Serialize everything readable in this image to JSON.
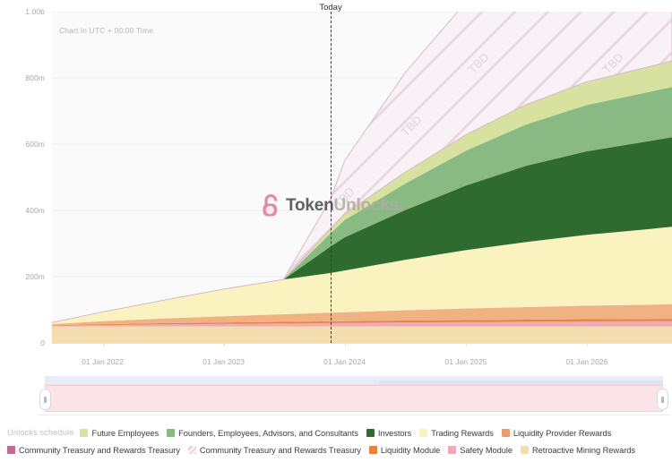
{
  "chart_data": {
    "type": "area",
    "title": "",
    "subtitle": "Chart in UTC + 00:00 Time",
    "xlabel": "",
    "ylabel": "",
    "ylim": [
      0,
      1000000000
    ],
    "grid": true,
    "legend_position": "bottom",
    "stacked": true,
    "marker": {
      "label": "Today",
      "x": "2023-11-20"
    },
    "hatch_label": "TBD",
    "y_ticks": [
      {
        "value": 0,
        "label": "0"
      },
      {
        "value": 200000000,
        "label": "200m"
      },
      {
        "value": 400000000,
        "label": "400m"
      },
      {
        "value": 600000000,
        "label": "600m"
      },
      {
        "value": 800000000,
        "label": "800m"
      },
      {
        "value": 1000000000,
        "label": "1.00b"
      }
    ],
    "x_ticks": [
      {
        "value": "2022-01-01",
        "label": "01 Jan 2022"
      },
      {
        "value": "2023-01-01",
        "label": "01 Jan 2023"
      },
      {
        "value": "2024-01-01",
        "label": "01 Jan 2024"
      },
      {
        "value": "2025-01-01",
        "label": "01 Jan 2025"
      },
      {
        "value": "2026-01-01",
        "label": "01 Jan 2026"
      }
    ],
    "x": [
      "2021-08-01",
      "2022-01-01",
      "2022-07-01",
      "2023-01-01",
      "2023-07-01",
      "2023-11-20",
      "2024-01-01",
      "2024-07-01",
      "2025-01-01",
      "2025-07-01",
      "2026-01-01",
      "2026-07-01",
      "2026-09-15"
    ],
    "series": [
      {
        "name": "Retroactive Mining Rewards",
        "color": "#f3dcae",
        "values": [
          50000000,
          50000000,
          50000000,
          50000000,
          50000000,
          50000000,
          50000000,
          50000000,
          50000000,
          50000000,
          50000000,
          50000000,
          50000000
        ]
      },
      {
        "name": "Safety Module",
        "color": "#eeaabb",
        "values": [
          2000000,
          4000000,
          6000000,
          7500000,
          9000000,
          10000000,
          10500000,
          12000000,
          13000000,
          14000000,
          15000000,
          15500000,
          16000000
        ]
      },
      {
        "name": "Liquidity Module",
        "color": "#e8833f",
        "values": [
          1500000,
          2500000,
          3500000,
          4000000,
          4500000,
          5000000,
          5200000,
          5600000,
          6000000,
          6200000,
          6500000,
          6600000,
          6700000
        ]
      },
      {
        "name": "Liquidity Provider Rewards",
        "color": "#f0b283",
        "values": [
          3000000,
          9000000,
          14000000,
          19000000,
          23000000,
          26000000,
          27000000,
          31000000,
          35000000,
          38000000,
          41000000,
          43000000,
          44000000
        ]
      },
      {
        "name": "Trading Rewards",
        "color": "#faf3bf",
        "values": [
          5000000,
          28000000,
          55000000,
          82000000,
          105000000,
          120000000,
          126000000,
          152000000,
          176000000,
          196000000,
          214000000,
          228000000,
          234000000
        ]
      },
      {
        "name": "Investors",
        "color": "#2f6b2f",
        "values": [
          0,
          0,
          0,
          0,
          0,
          80000000,
          100000000,
          150000000,
          195000000,
          230000000,
          252000000,
          265000000,
          270000000
        ]
      },
      {
        "name": "Founders, Employees, Advisors, and Consultants",
        "color": "#8aba84",
        "values": [
          0,
          0,
          0,
          0,
          0,
          40000000,
          52000000,
          80000000,
          105000000,
          125000000,
          140000000,
          148000000,
          152000000
        ]
      },
      {
        "name": "Future Employees",
        "color": "#d8e2a0",
        "values": [
          0,
          0,
          0,
          0,
          0,
          14000000,
          19000000,
          34000000,
          48000000,
          60000000,
          70000000,
          76000000,
          79000000
        ]
      },
      {
        "name": "Community Treasury and Rewards Treasury",
        "color": "#bf6b93",
        "values": [
          0,
          0,
          0,
          0,
          0,
          0,
          0,
          0,
          0,
          0,
          0,
          0,
          0
        ]
      },
      {
        "name": "Community Treasury and Rewards Treasury (TBD)",
        "color": "#f7eef3",
        "hatched": true,
        "values": [
          0,
          0,
          0,
          0,
          0,
          90000000,
          160000000,
          300000000,
          400000000,
          470000000,
          520000000,
          553000000,
          560000000
        ]
      }
    ]
  },
  "axis": {
    "y_labels": [
      "1.00b",
      "800m",
      "600m",
      "400m",
      "200m"
    ],
    "zero_label": "0",
    "x_labels": [
      "01 Jan 2022",
      "01 Jan 2023",
      "01 Jan 2024",
      "01 Jan 2025",
      "01 Jan 2026"
    ]
  },
  "annotations": {
    "utc_note": "Chart in UTC + 00:00 Time",
    "today_label": "Today"
  },
  "watermark": {
    "text_primary": "Token",
    "text_secondary": "Unlocks.",
    "logo_color": "#e07a9c"
  },
  "legend": {
    "title": "Unlocks schedule",
    "row1": [
      {
        "label": "Future Employees",
        "color": "#d8e2a0"
      },
      {
        "label": "Founders, Employees, Advisors, and Consultants",
        "color": "#8aba84"
      },
      {
        "label": "Investors",
        "color": "#2f6b2f"
      },
      {
        "label": "Trading Rewards",
        "color": "#faf3bf"
      },
      {
        "label": "Liquidity Provider Rewards",
        "color": "#ef9a6a"
      }
    ],
    "row2": [
      {
        "label": "Community Treasury and Rewards Treasury",
        "color": "#bf6b93"
      },
      {
        "label": "Community Treasury and Rewards Treasury",
        "color": "#f7eef3",
        "hatched": true
      },
      {
        "label": "Liquidity Module",
        "color": "#e8833f"
      },
      {
        "label": "Safety Module",
        "color": "#eeaabb"
      },
      {
        "label": "Retroactive Mining Rewards",
        "color": "#f3dcae"
      }
    ]
  },
  "range_slider": {
    "start_pct": 0,
    "end_pct": 100
  }
}
